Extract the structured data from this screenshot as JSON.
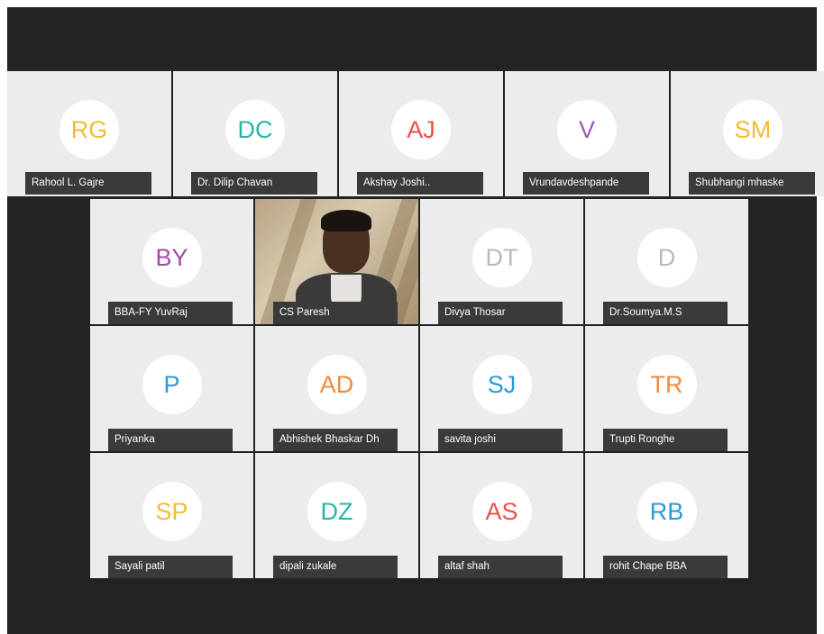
{
  "colors": {
    "yellow": "#f2bb3a",
    "teal": "#2bb5a6",
    "red": "#e8524a",
    "purple": "#9b59b6",
    "orange": "#f08a3a",
    "blue": "#2c9ad6",
    "grey": "#b9b9b9",
    "magenta": "#a24ba7"
  },
  "top_row": [
    {
      "initials": "RG",
      "name": "Rahool L. Gajre",
      "color": "#f2bb3a"
    },
    {
      "initials": "DC",
      "name": "Dr. Dilip Chavan",
      "color": "#2bb5a6"
    },
    {
      "initials": "AJ",
      "name": "Akshay Joshi..",
      "color": "#e8524a"
    },
    {
      "initials": "V",
      "name": "Vrundavdeshpande",
      "color": "#9b59b6"
    },
    {
      "initials": "SM",
      "name": "Shubhangi mhaske",
      "color": "#f2bb3a"
    }
  ],
  "row2": [
    {
      "initials": "BY",
      "name": "BBA-FY YuvRaj",
      "color": "#a24ba7"
    },
    {
      "initials": "",
      "name": "CS Paresh",
      "color": "",
      "video": true
    },
    {
      "initials": "DT",
      "name": "Divya Thosar",
      "color": "#b9b9b9"
    },
    {
      "initials": "D",
      "name": "Dr.Soumya.M.S",
      "color": "#b9b9b9"
    }
  ],
  "row3": [
    {
      "initials": "P",
      "name": "Priyanka",
      "color": "#2c9ad6"
    },
    {
      "initials": "AD",
      "name": "Abhishek Bhaskar Dh",
      "color": "#f08a3a"
    },
    {
      "initials": "SJ",
      "name": "savita joshi",
      "color": "#2c9ad6"
    },
    {
      "initials": "TR",
      "name": "Trupti Ronghe",
      "color": "#f08a3a"
    }
  ],
  "row4": [
    {
      "initials": "SP",
      "name": "Sayali patil",
      "color": "#f2bb3a"
    },
    {
      "initials": "DZ",
      "name": "dipali zukale",
      "color": "#2bb5a6"
    },
    {
      "initials": "AS",
      "name": "altaf shah",
      "color": "#e8524a"
    },
    {
      "initials": "RB",
      "name": "rohit Chape BBA",
      "color": "#2c9ad6"
    }
  ]
}
